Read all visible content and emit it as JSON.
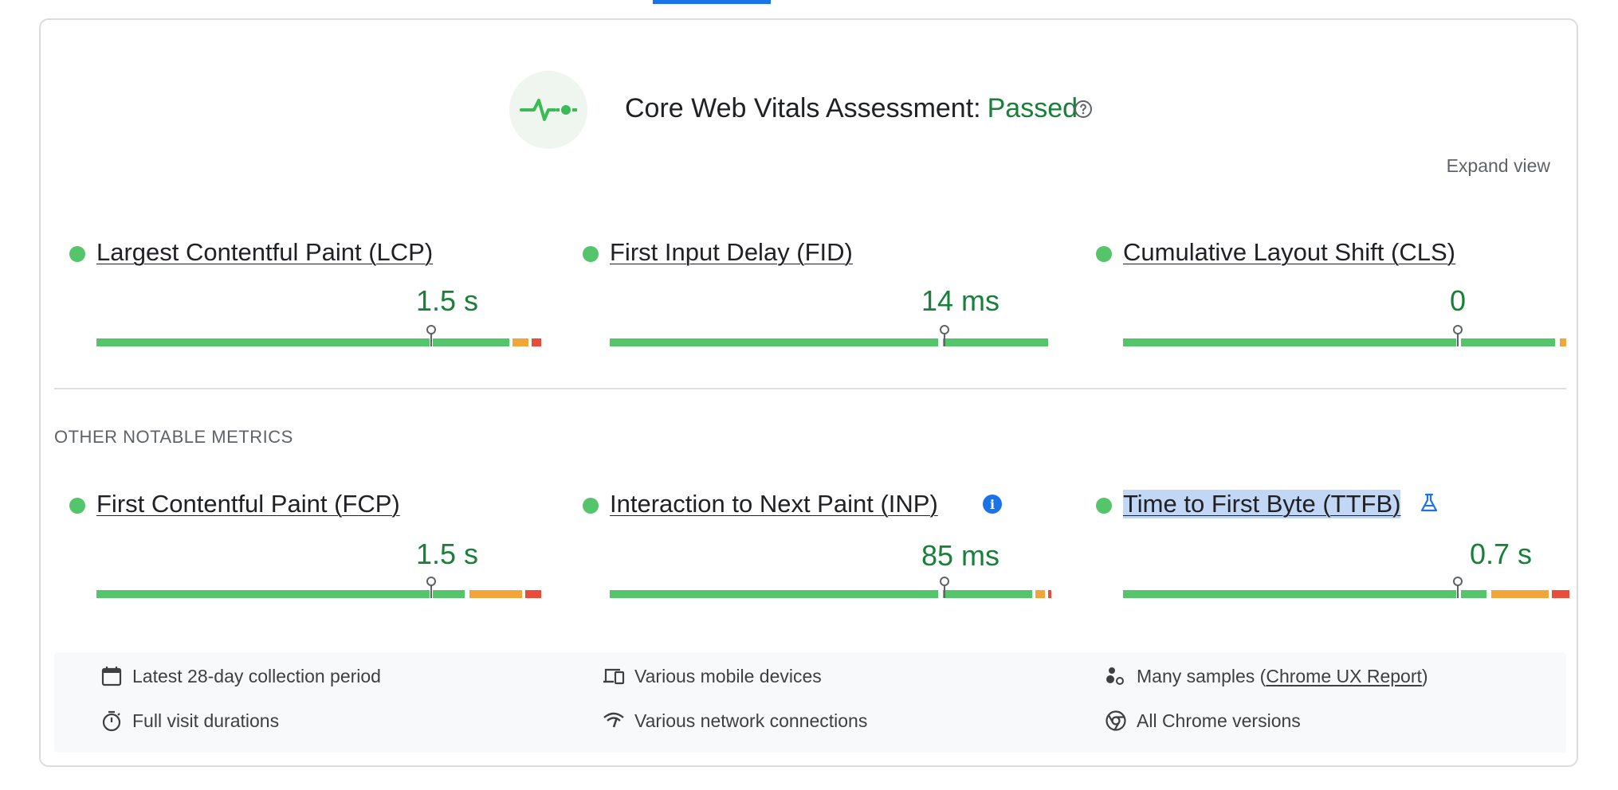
{
  "header": {
    "title_prefix": "Core Web Vitals Assessment:",
    "status": "Passed",
    "icon": "pulse-icon",
    "help_icon": "help-icon",
    "status_color": "#188038"
  },
  "expand_view": "Expand view",
  "core_metrics": [
    {
      "name": "Largest Contentful Paint (LCP)",
      "value": "1.5 s",
      "status_color": "#55c56c"
    },
    {
      "name": "First Input Delay (FID)",
      "value": "14 ms",
      "status_color": "#55c56c"
    },
    {
      "name": "Cumulative Layout Shift (CLS)",
      "value": "0",
      "status_color": "#55c56c"
    }
  ],
  "other_section_label": "OTHER NOTABLE METRICS",
  "other_metrics": [
    {
      "name": "First Contentful Paint (FCP)",
      "value": "1.5 s",
      "status_color": "#55c56c"
    },
    {
      "name": "Interaction to Next Paint (INP)",
      "value": "85 ms",
      "status_color": "#55c56c",
      "badge": "i"
    },
    {
      "name": "Time to First Byte (TTFB)",
      "value": "0.7 s",
      "status_color": "#55c56c",
      "badge_icon": "flask-icon"
    }
  ],
  "footer": {
    "collection_period": "Latest 28-day collection period",
    "visit_durations": "Full visit durations",
    "devices": "Various mobile devices",
    "network": "Various network connections",
    "samples_prefix": "Many samples (",
    "samples_link": "Chrome UX Report",
    "samples_suffix": ")",
    "chrome_versions": "All Chrome versions"
  },
  "colors": {
    "good": "#55c56c",
    "needs_improvement": "#f2a63a",
    "poor": "#ea4c3b",
    "accent": "#1a73e8"
  }
}
